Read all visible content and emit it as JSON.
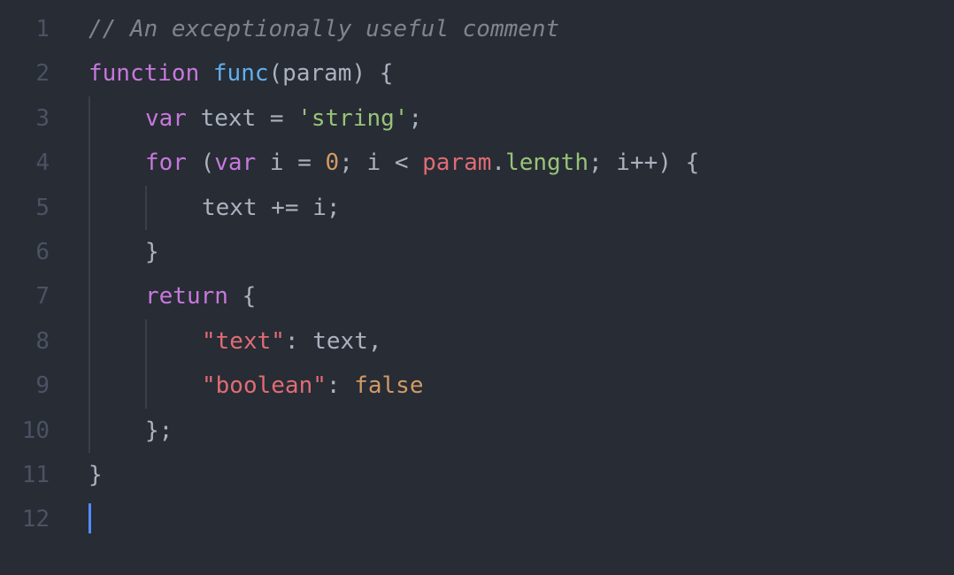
{
  "editor": {
    "line_numbers": [
      "1",
      "2",
      "3",
      "4",
      "5",
      "6",
      "7",
      "8",
      "9",
      "10",
      "11",
      "12"
    ],
    "lines": [
      {
        "indent": 1,
        "guides": [],
        "tokens": [
          {
            "cls": "c-comment",
            "text": "// An exceptionally useful comment"
          }
        ]
      },
      {
        "indent": 1,
        "guides": [],
        "tokens": [
          {
            "cls": "c-keyword",
            "text": "function"
          },
          {
            "cls": "c-punc",
            "text": " "
          },
          {
            "cls": "c-funcname",
            "text": "func"
          },
          {
            "cls": "c-punc",
            "text": "("
          },
          {
            "cls": "c-param",
            "text": "param"
          },
          {
            "cls": "c-punc",
            "text": ") {"
          }
        ]
      },
      {
        "indent": 2,
        "guides": [
          1
        ],
        "tokens": [
          {
            "cls": "c-keyword",
            "text": "var"
          },
          {
            "cls": "c-punc",
            "text": " "
          },
          {
            "cls": "c-var",
            "text": "text "
          },
          {
            "cls": "c-op",
            "text": "="
          },
          {
            "cls": "c-punc",
            "text": " "
          },
          {
            "cls": "c-str",
            "text": "'string'"
          },
          {
            "cls": "c-punc",
            "text": ";"
          }
        ]
      },
      {
        "indent": 2,
        "guides": [
          1
        ],
        "tokens": [
          {
            "cls": "c-keyword",
            "text": "for"
          },
          {
            "cls": "c-punc",
            "text": " ("
          },
          {
            "cls": "c-keyword",
            "text": "var"
          },
          {
            "cls": "c-punc",
            "text": " "
          },
          {
            "cls": "c-var",
            "text": "i "
          },
          {
            "cls": "c-op",
            "text": "="
          },
          {
            "cls": "c-punc",
            "text": " "
          },
          {
            "cls": "c-num",
            "text": "0"
          },
          {
            "cls": "c-punc",
            "text": "; "
          },
          {
            "cls": "c-var",
            "text": "i "
          },
          {
            "cls": "c-op",
            "text": "<"
          },
          {
            "cls": "c-punc",
            "text": " "
          },
          {
            "cls": "c-key",
            "text": "param"
          },
          {
            "cls": "c-punc",
            "text": "."
          },
          {
            "cls": "c-prop2",
            "text": "length"
          },
          {
            "cls": "c-punc",
            "text": "; "
          },
          {
            "cls": "c-var",
            "text": "i"
          },
          {
            "cls": "c-op",
            "text": "++"
          },
          {
            "cls": "c-punc",
            "text": ") {"
          }
        ]
      },
      {
        "indent": 3,
        "guides": [
          1,
          2
        ],
        "tokens": [
          {
            "cls": "c-var",
            "text": "text "
          },
          {
            "cls": "c-op",
            "text": "+="
          },
          {
            "cls": "c-punc",
            "text": " "
          },
          {
            "cls": "c-var",
            "text": "i"
          },
          {
            "cls": "c-punc",
            "text": ";"
          }
        ]
      },
      {
        "indent": 2,
        "guides": [
          1
        ],
        "tokens": [
          {
            "cls": "c-punc",
            "text": "}"
          }
        ]
      },
      {
        "indent": 2,
        "guides": [
          1
        ],
        "tokens": [
          {
            "cls": "c-keyword",
            "text": "return"
          },
          {
            "cls": "c-punc",
            "text": " {"
          }
        ]
      },
      {
        "indent": 3,
        "guides": [
          1,
          2
        ],
        "tokens": [
          {
            "cls": "c-key",
            "text": "\"text\""
          },
          {
            "cls": "c-punc",
            "text": ": "
          },
          {
            "cls": "c-var",
            "text": "text"
          },
          {
            "cls": "c-punc",
            "text": ","
          }
        ]
      },
      {
        "indent": 3,
        "guides": [
          1,
          2
        ],
        "tokens": [
          {
            "cls": "c-key",
            "text": "\"boolean\""
          },
          {
            "cls": "c-punc",
            "text": ": "
          },
          {
            "cls": "c-const",
            "text": "false"
          }
        ]
      },
      {
        "indent": 2,
        "guides": [
          1
        ],
        "tokens": [
          {
            "cls": "c-punc",
            "text": "};"
          }
        ]
      },
      {
        "indent": 1,
        "guides": [],
        "tokens": [
          {
            "cls": "c-punc",
            "text": "}"
          }
        ]
      },
      {
        "indent": 1,
        "guides": [],
        "cursor": true,
        "tokens": []
      }
    ]
  }
}
